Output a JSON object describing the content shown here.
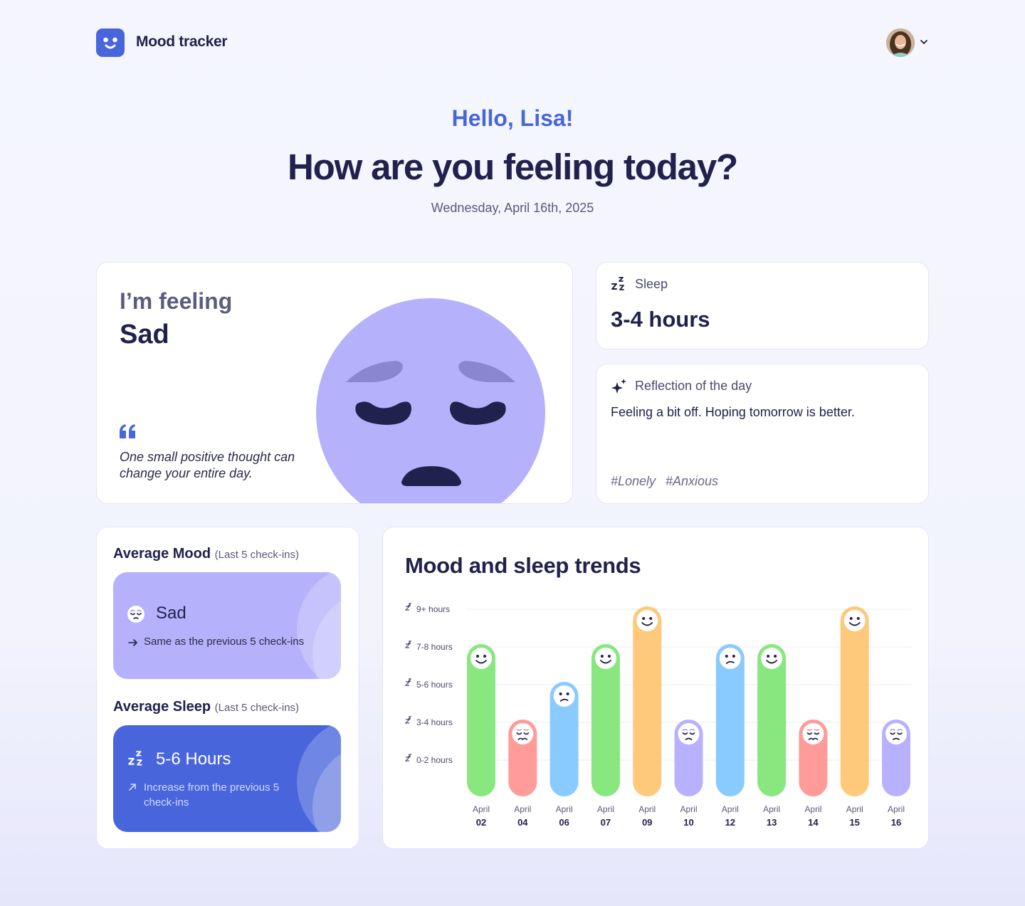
{
  "header": {
    "brand": "Mood tracker",
    "avatar": "user-avatar",
    "menu_icon": "chevron-down-icon"
  },
  "hero": {
    "greeting": "Hello, Lisa!",
    "question": "How are you feeling today?",
    "date": "Wednesday, April 16th, 2025"
  },
  "feeling": {
    "prefix": "I’m feeling",
    "value": "Sad",
    "quote": "One small positive thought can change your entire day.",
    "face": "sad-face"
  },
  "sleep": {
    "label": "Sleep",
    "value": "3-4 hours",
    "icon": "sleep-icon"
  },
  "reflection": {
    "label": "Reflection of the day",
    "text": "Feeling a bit off. Hoping tomorrow is better.",
    "tags": [
      "#Lonely",
      "#Anxious"
    ],
    "icon": "sparkle-icon"
  },
  "averages": {
    "mood_title": "Average Mood",
    "mood_note": "(Last 5 check-ins)",
    "mood_value": "Sad",
    "mood_change": "Same as the previous 5 check-ins",
    "sleep_title": "Average Sleep",
    "sleep_note": "(Last 5 check-ins)",
    "sleep_value": "5-6 Hours",
    "sleep_change": "Increase from the previous 5 check-ins"
  },
  "trends": {
    "title": "Mood and sleep trends"
  },
  "colors": {
    "accent": "#4865dc",
    "joyful": "#ffc97c",
    "happy": "#89e780",
    "neutral": "#89caff",
    "sad": "#b8b1ff",
    "very_sad": "#ff9b99"
  },
  "chart_data": {
    "type": "bar",
    "y_levels": [
      "0-2 hours",
      "3-4 hours",
      "5-6 hours",
      "7-8 hours",
      "9+ hours"
    ],
    "month": "April",
    "categories": [
      "02",
      "04",
      "06",
      "07",
      "09",
      "10",
      "12",
      "13",
      "14",
      "15",
      "16"
    ],
    "sleep_level": [
      3,
      1,
      2,
      3,
      4,
      1,
      3,
      3,
      1,
      4,
      1
    ],
    "mood": [
      "happy",
      "very_sad",
      "neutral",
      "happy",
      "joyful",
      "sad",
      "neutral",
      "happy",
      "very_sad",
      "joyful",
      "sad"
    ]
  }
}
